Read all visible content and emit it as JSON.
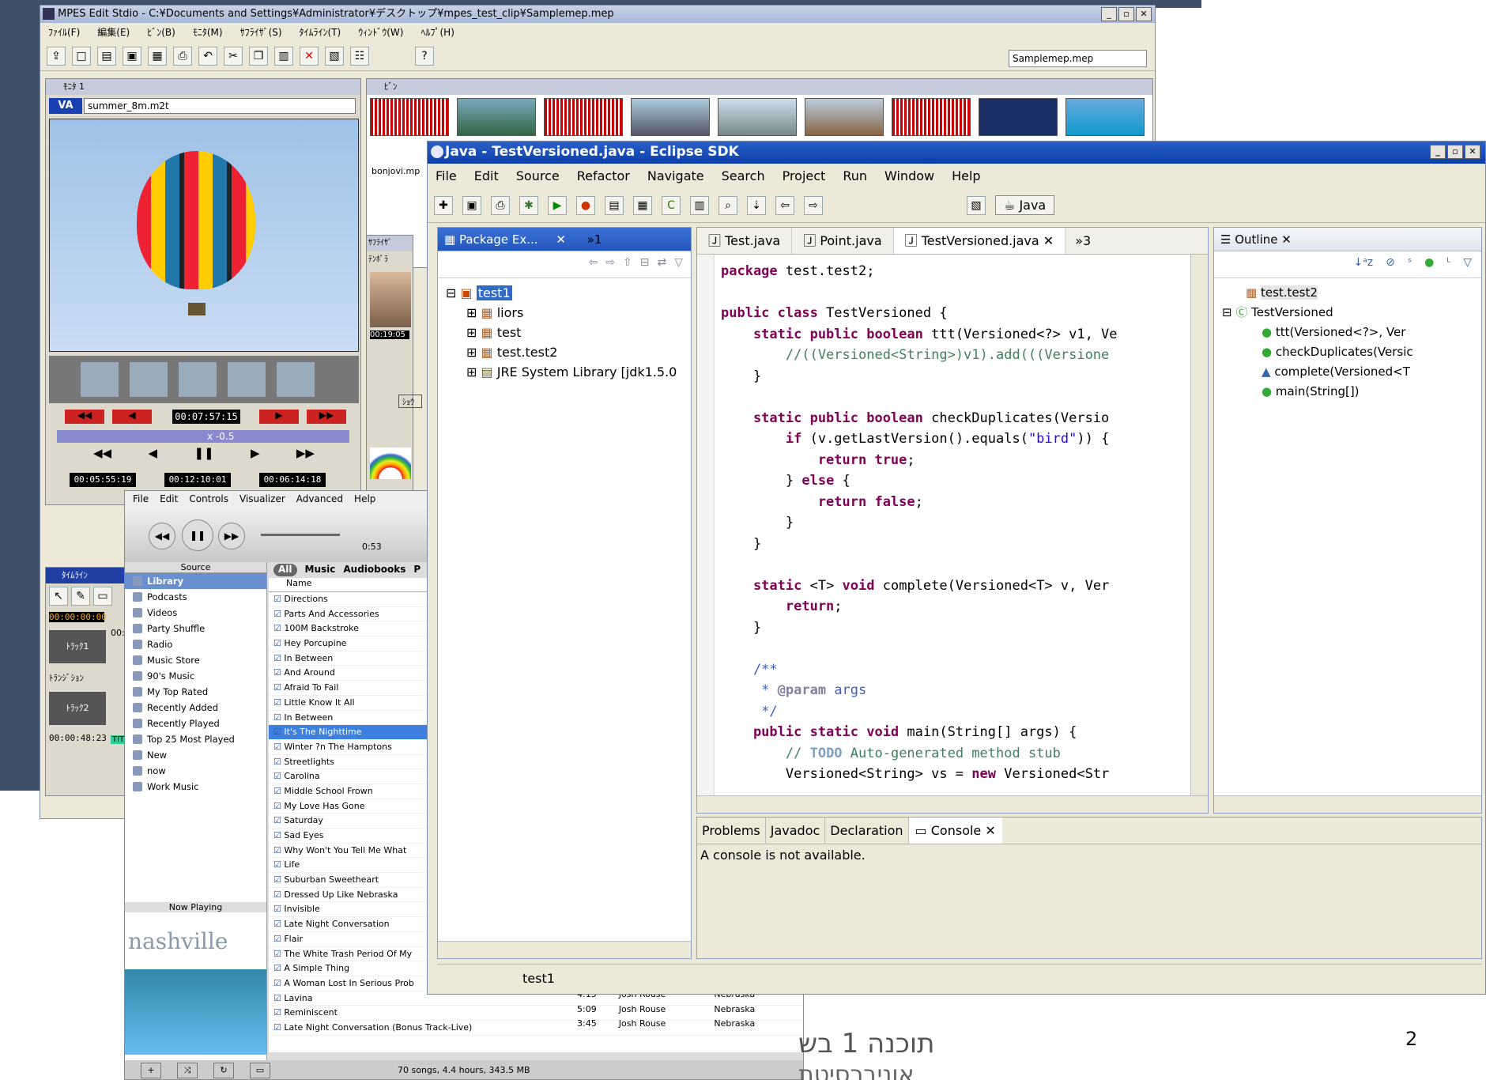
{
  "slide": {
    "page_number": "2",
    "caption_line1": "תוכנה 1 בש",
    "caption_line2": "אוניברסיטת"
  },
  "mpes": {
    "title": "MPES Edit Stdio - C:¥Documents and Settings¥Administrator¥デスクトップ¥mpes_test_clip¥Samplemep.mep",
    "menu": [
      "ﾌｧｲﾙ(F)",
      "編集(E)",
      "ﾋﾞﾝ(B)",
      "ﾓﾆﾀ(M)",
      "ｻﾌﾗｲｻﾞ(S)",
      "ﾀｲﾑﾗｲﾝ(T)",
      "ｳｨﾝﾄﾞｳ(W)",
      "ﾍﾙﾌﾟ(H)"
    ],
    "project_select": "Samplemep.mep",
    "monitor_title": "ﾓﾆﾀ 1",
    "clip_name": "summer_8m.m2t",
    "timecode_main": "00:07:57:15",
    "speed": "x -0.5",
    "tc_in": "00:05:55:19",
    "tc_out": "00:12:10:01",
    "tc_dur": "00:06:14:18",
    "bin_title": "ﾋﾞﾝ",
    "bin_clip": "bonjovi.mp",
    "suplizer_label": "ｻﾌﾗｲｻﾞ",
    "tempo_label": "ﾃﾝﾎﾟﾗ",
    "suplizer_time": "00:19:05",
    "timeline_title": "ﾀｲﾑﾗｲﾝ",
    "timeline_tc": "00:00:00:00",
    "timeline_tc2": "00:",
    "track1": "ﾄﾗｯｸ1",
    "transition": "ﾄﾗﾝｼﾞｼｮﾝ",
    "track2": "ﾄﾗｯｸ2",
    "timeline_end": "00:00:48:23",
    "show_label": "ｼｮｳ",
    "title_label": "TIT"
  },
  "itunes": {
    "menu": [
      "File",
      "Edit",
      "Controls",
      "Visualizer",
      "Advanced",
      "Help"
    ],
    "elapsed": "0:53",
    "source_header": "Source",
    "sources": [
      "Library",
      "Podcasts",
      "Videos",
      "Party Shuffle",
      "Radio",
      "Music Store",
      "90's Music",
      "My Top Rated",
      "Recently Added",
      "Recently Played",
      "Top 25 Most Played",
      "New",
      "now",
      "Work Music"
    ],
    "filter_tabs": [
      "All",
      "Music",
      "Audiobooks",
      "P"
    ],
    "name_header": "Name",
    "songs": [
      "Directions",
      "Parts And Accessories",
      "100M Backstroke",
      "Hey Porcupine",
      "In Between",
      "And Around",
      "Afraid To Fail",
      "Little Know It All",
      "In Between",
      "It's The Nighttime",
      "Winter ?n The Hamptons",
      "Streetlights",
      "Carolina",
      "Middle School Frown",
      "My Love Has Gone",
      "Saturday",
      "Sad Eyes",
      "Why Won't You Tell Me What",
      "Life",
      "Suburban Sweetheart",
      "Dressed Up Like Nebraska",
      "Invisible",
      "Late Night Conversation",
      "Flair",
      "The White Trash Period Of My",
      "A Simple Thing",
      "A Woman Lost In Serious Prob",
      "Lavina",
      "Reminiscent",
      "Late Night Conversation (Bonus Track-Live)"
    ],
    "selected_song": "It's The Nighttime",
    "extra_rows": [
      {
        "time": "4:15",
        "artist": "Josh Rouse",
        "album": "Nebraska"
      },
      {
        "time": "5:09",
        "artist": "Josh Rouse",
        "album": "Nebraska"
      },
      {
        "time": "3:45",
        "artist": "Josh Rouse",
        "album": "Nebraska"
      }
    ],
    "now_playing": "Now Playing",
    "album_art_text": "nashville",
    "status": "70 songs, 4.4 hours, 343.5 MB"
  },
  "eclipse": {
    "title": "Java - TestVersioned.java - Eclipse SDK",
    "menu": [
      "File",
      "Edit",
      "Source",
      "Refactor",
      "Navigate",
      "Search",
      "Project",
      "Run",
      "Window",
      "Help"
    ],
    "perspective": "Java",
    "package_explorer": "Package Ex...",
    "pe_overflow": "»1",
    "tree": [
      "test1",
      "liors",
      "test",
      "test.test2",
      "JRE System Library [jdk1.5.0"
    ],
    "editor_tabs": [
      "Test.java",
      "Point.java",
      "TestVersioned.java"
    ],
    "editor_overflow": "»3",
    "outline": "Outline",
    "outline_items": [
      "test.test2",
      "TestVersioned",
      "ttt(Versioned<?>, Ver",
      "checkDuplicates(Versic",
      "complete(Versioned<T",
      "main(String[])"
    ],
    "code": {
      "l1a": "package",
      "l1b": " test.test2;",
      "l2a": "public class",
      "l2b": " TestVersioned {",
      "l3a": "    static public boolean",
      "l3b": " ttt(Versioned<?> v1, Ve",
      "l4": "        //((Versioned<String>)v1).add(((Versione",
      "l5": "    }",
      "l6a": "    static public boolean",
      "l6b": " checkDuplicates(Versio",
      "l7a": "        if",
      "l7b": " (v.getLastVersion().equals(",
      "l7c": "\"bird\"",
      "l7d": ")) {",
      "l8a": "            return true",
      "l8b": ";",
      "l9a": "        } ",
      "l9b": "else",
      "l9c": " {",
      "l10a": "            return false",
      "l10b": ";",
      "l11": "        }",
      "l12": "    }",
      "l13a": "    static",
      "l13b": " <T> ",
      "l13c": "void",
      "l13d": " complete(Versioned<T> v, Ver",
      "l14a": "        return",
      "l14b": ";",
      "l15": "    }",
      "l16": "    /**",
      "l17a": "     * ",
      "l17b": "@param",
      "l17c": " args",
      "l18": "     */",
      "l19a": "    public static void",
      "l19b": " main(String[] args) {",
      "l20a": "        // ",
      "l20b": "TODO",
      "l20c": " Auto-generated method stub",
      "l21a": "        Versioned<String> vs = ",
      "l21b": "new",
      "l21c": " Versioned<Str"
    },
    "bottom_tabs": [
      "Problems",
      "Javadoc",
      "Declaration",
      "Console"
    ],
    "console_msg": "A console is not available.",
    "status": "test1"
  }
}
